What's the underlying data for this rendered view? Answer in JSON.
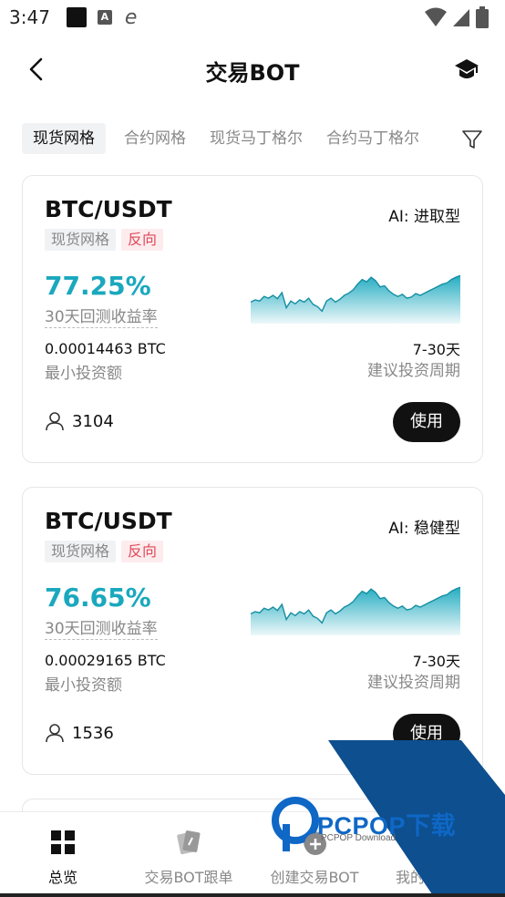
{
  "status": {
    "time": "3:47",
    "a_icon": "A"
  },
  "header": {
    "title": "交易BOT"
  },
  "tabs": [
    "现货网格",
    "合约网格",
    "现货马丁格尔",
    "合约马丁格尔"
  ],
  "cards": [
    {
      "pair": "BTC/USDT",
      "ai_type": "AI: 进取型",
      "tag1": "现货网格",
      "tag2": "反向",
      "roi": "77.25%",
      "roi_label": "30天回测收益率",
      "min_invest": "0.00014463 BTC",
      "min_invest_label": "最小投资额",
      "period": "7-30天",
      "period_label": "建议投资周期",
      "users": "3104",
      "use_label": "使用",
      "spark": [
        0.62,
        0.58,
        0.6,
        0.52,
        0.55,
        0.5,
        0.56,
        0.45,
        0.72,
        0.6,
        0.65,
        0.58,
        0.62,
        0.55,
        0.66,
        0.7,
        0.78,
        0.6,
        0.55,
        0.62,
        0.57,
        0.5,
        0.46,
        0.4,
        0.3,
        0.22,
        0.26,
        0.18,
        0.24,
        0.35,
        0.33,
        0.42,
        0.48,
        0.52,
        0.48,
        0.55,
        0.53,
        0.47,
        0.5,
        0.46,
        0.42,
        0.38,
        0.34,
        0.3,
        0.28,
        0.22,
        0.18,
        0.15
      ]
    },
    {
      "pair": "BTC/USDT",
      "ai_type": "AI: 稳健型",
      "tag1": "现货网格",
      "tag2": "反向",
      "roi": "76.65%",
      "roi_label": "30天回测收益率",
      "min_invest": "0.00029165 BTC",
      "min_invest_label": "最小投资额",
      "period": "7-30天",
      "period_label": "建议投资周期",
      "users": "1536",
      "use_label": "使用",
      "spark": [
        0.62,
        0.58,
        0.6,
        0.52,
        0.55,
        0.5,
        0.56,
        0.45,
        0.72,
        0.6,
        0.65,
        0.58,
        0.62,
        0.55,
        0.66,
        0.7,
        0.78,
        0.6,
        0.55,
        0.62,
        0.57,
        0.5,
        0.46,
        0.4,
        0.3,
        0.22,
        0.26,
        0.18,
        0.24,
        0.35,
        0.33,
        0.42,
        0.48,
        0.52,
        0.48,
        0.55,
        0.53,
        0.47,
        0.5,
        0.46,
        0.42,
        0.38,
        0.34,
        0.3,
        0.28,
        0.22,
        0.18,
        0.15
      ]
    }
  ],
  "bottom_nav": [
    {
      "label": "总览",
      "icon": "overview-grid-icon",
      "active": true
    },
    {
      "label": "交易BOT跟单",
      "icon": "copy-trade-cards-icon",
      "active": false
    },
    {
      "label": "创建交易BOT",
      "icon": "create-bot-icon",
      "active": false
    },
    {
      "label": "我的交",
      "icon": "my-bots-icon",
      "active": false
    }
  ],
  "watermark": {
    "text": "PCPOP下载",
    "sub": "PCPOP Download"
  },
  "colors": {
    "accent": "#1aa8be",
    "danger": "#e04858",
    "watermark": "#0f67c6",
    "watermark_band": "#0d4f8f"
  }
}
